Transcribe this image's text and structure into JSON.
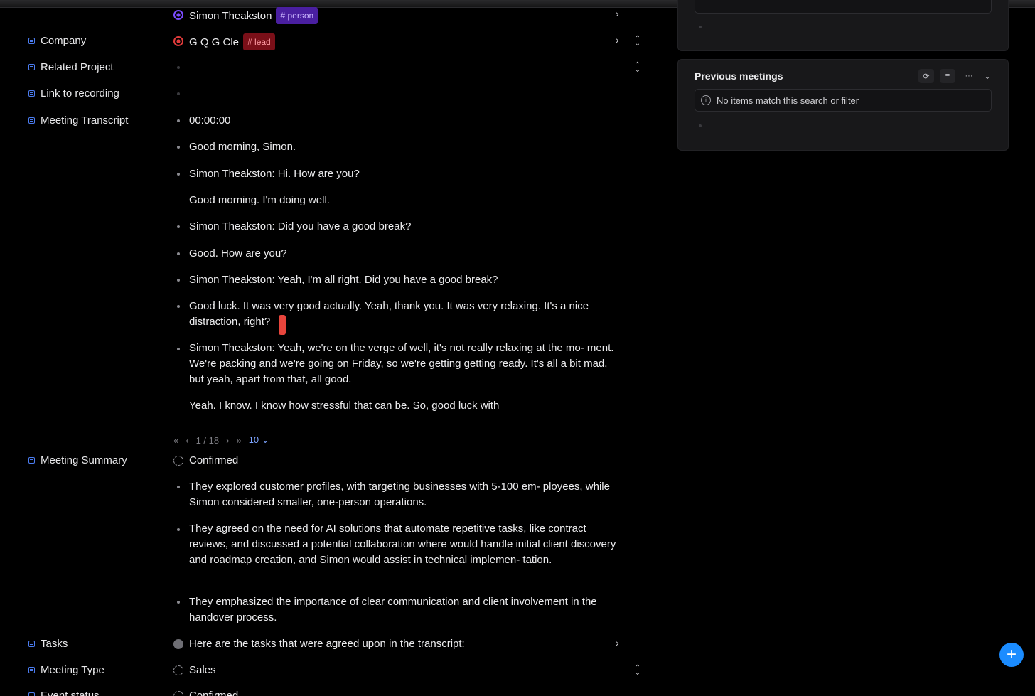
{
  "rows": {
    "attendee": {
      "name": "Simon Theakston",
      "tag": "# person"
    },
    "company": {
      "label": "Company",
      "name": "G Q G Cle",
      "tag": "# lead"
    },
    "related_project": {
      "label": "Related Project"
    },
    "recording": {
      "label": "Link to recording"
    },
    "transcript": {
      "label": "Meeting Transcript"
    },
    "summary": {
      "label": "Meeting Summary",
      "value": "Confirmed"
    },
    "tasks": {
      "label": "Tasks",
      "value": "Here are the tasks that were agreed upon in the transcript:"
    },
    "meeting_type": {
      "label": "Meeting Type",
      "value": "Sales"
    },
    "event_status": {
      "label": "Event status",
      "value": "Confirmed"
    }
  },
  "transcript_lines": [
    "00:00:00",
    "Go​od morning, Simon.",
    "Simon Theakston: Hi. How are you?",
    "Good morning. I'm doing well.",
    "Simon Theakston: Did you have a good break?",
    "Good. How are you?",
    "Simon Theakston: Yeah, I'm all right. Did you have a good break?",
    "Good luck. It was very good actually. Yeah, thank you. It was very relaxing. It's a nice distraction, right?",
    "Simon Theakston: Yeah, we're on the verge of well, it's not really relaxing at the mo- ment. We're packing and we're going on Friday, so we're getting getting ready. It's all a bit mad, but yeah, apart from that, all good.",
    "Yeah. I know. I know how stressful that can be. So, good luck with"
  ],
  "pager": {
    "first": "«",
    "prev": "‹",
    "page": "1 / 18",
    "next": "›",
    "last": "»",
    "size": "10"
  },
  "summary_lines": [
    "They explored customer profiles, with targeting businesses with 5-100 em- ployees, while Simon considered smaller, one-person operations.",
    "They agreed on the need for AI solutions that automate repetitive tasks, like contract reviews, and discussed a potential collaboration where would handle initial client discovery and roadmap creation, and Simon would assist in technical implemen- tation.",
    "They emphasized the importance of clear communication and client involvement in the handover process."
  ],
  "previous_meetings": {
    "title": "Previous meetings",
    "empty": "No items match this search or filter"
  },
  "colors": {
    "accent": "#1b8cff",
    "person_tag": "#4a1fa0",
    "lead_tag": "#7a0f18"
  },
  "fab": "+"
}
